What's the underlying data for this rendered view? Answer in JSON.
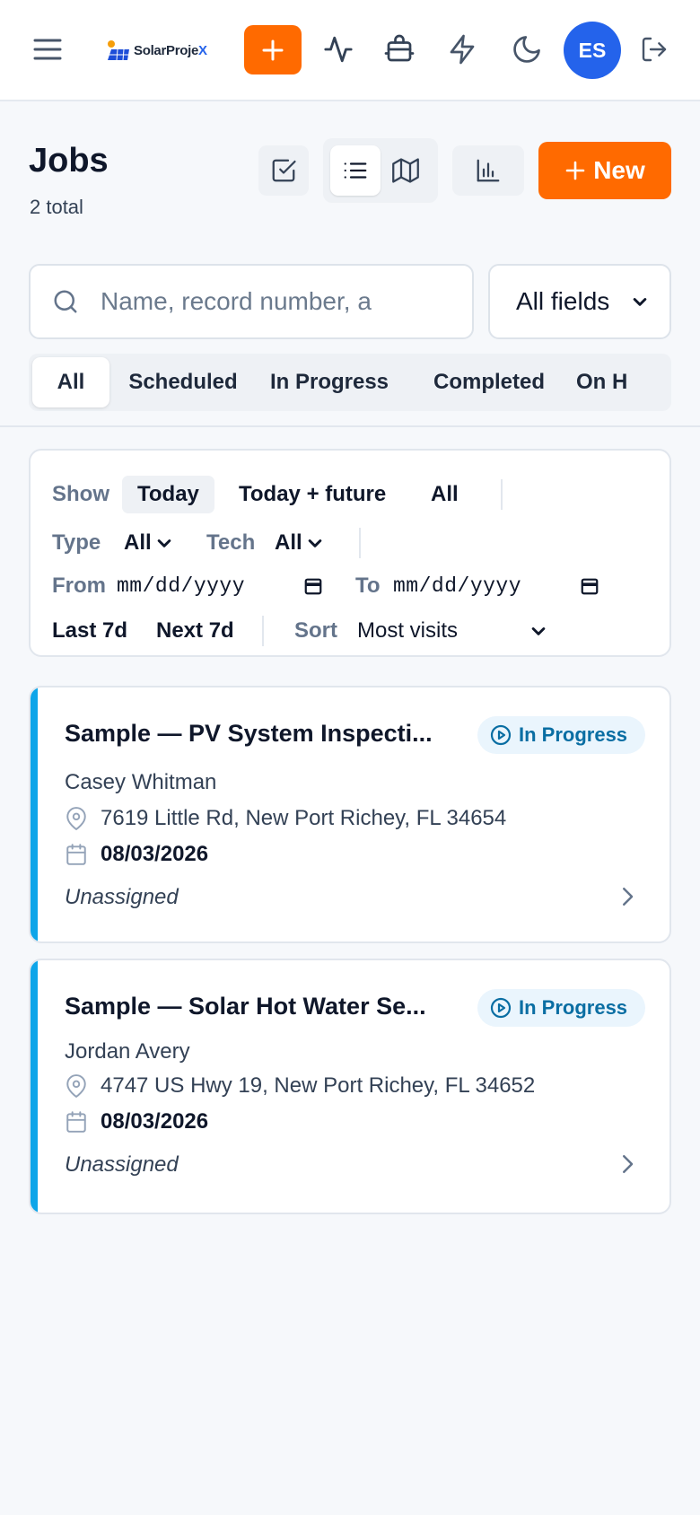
{
  "app": {
    "logo_main": "SolarProje",
    "logo_accent": "X",
    "avatar_initials": "ES"
  },
  "header": {
    "title": "Jobs",
    "total": "2 total",
    "new_label": "New"
  },
  "search": {
    "placeholder": "Name, record number, a",
    "scope": "All fields"
  },
  "tabs": [
    {
      "label": "All",
      "active": true
    },
    {
      "label": "Scheduled"
    },
    {
      "label": "In Progress"
    },
    {
      "label": "Completed"
    },
    {
      "label": "On H"
    }
  ],
  "filters": {
    "show_label": "Show",
    "show_options": [
      "Today",
      "Today + future",
      "All"
    ],
    "show_selected": "Today",
    "type_label": "Type",
    "type_value": "All",
    "tech_label": "Tech",
    "tech_value": "All",
    "from_label": "From",
    "from_placeholder": "mm/dd/yyyy",
    "to_label": "To",
    "to_placeholder": "mm/dd/yyyy",
    "quick_ranges": [
      "Last 7d",
      "Next 7d"
    ],
    "sort_label": "Sort",
    "sort_value": "Most visits"
  },
  "jobs": [
    {
      "title": "Sample — PV System Inspecti...",
      "status": "In Progress",
      "customer": "Casey Whitman",
      "address": "7619 Little Rd, New Port Richey, FL 34654",
      "date": "08/03/2026",
      "assignee": "Unassigned"
    },
    {
      "title": "Sample — Solar Hot Water Se...",
      "status": "In Progress",
      "customer": "Jordan Avery",
      "address": "4747 US Hwy 19, New Port Richey, FL 34652",
      "date": "08/03/2026",
      "assignee": "Unassigned"
    }
  ],
  "colors": {
    "accent_orange": "#ff6a00",
    "avatar_blue": "#2463eb",
    "status_blue": "#0a6ea3",
    "card_accent": "#0ea5e9"
  }
}
